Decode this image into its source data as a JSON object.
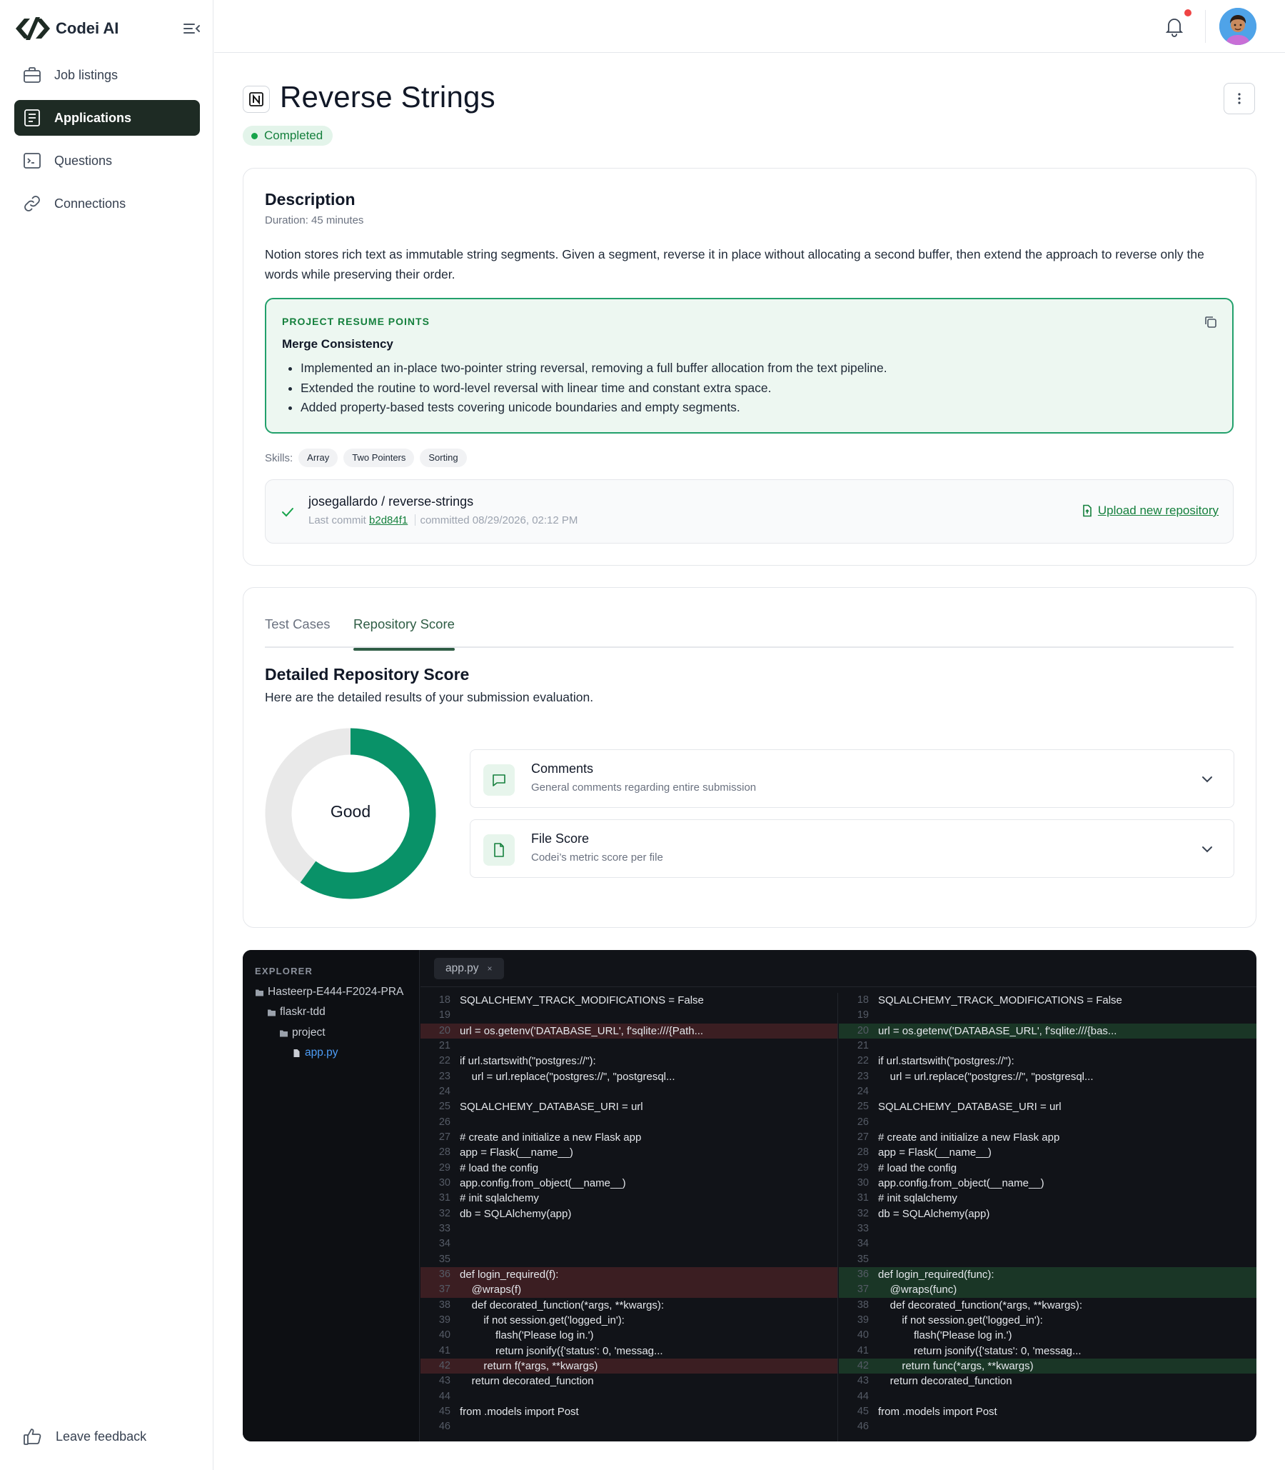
{
  "app": {
    "name": "Codei AI",
    "nav": [
      {
        "label": "Job listings",
        "icon": "briefcase-icon",
        "active": false
      },
      {
        "label": "Applications",
        "icon": "document-icon",
        "active": true
      },
      {
        "label": "Questions",
        "icon": "terminal-icon",
        "active": false
      },
      {
        "label": "Connections",
        "icon": "link-icon",
        "active": false
      }
    ],
    "feedback_label": "Leave feedback",
    "accent": "#1e2b24"
  },
  "header": {
    "title": "Reverse Strings",
    "status": "Completed",
    "status_color": "#15803d"
  },
  "description": {
    "title": "Description",
    "duration": "Duration: 45 minutes",
    "text": "Notion stores rich text as immutable string segments. Given a segment, reverse it in place without allocating a second buffer, then extend the approach to reverse only the words while preserving their order."
  },
  "resume": {
    "label": "PROJECT RESUME POINTS",
    "subtitle": "Merge Consistency",
    "points": [
      "Implemented an in-place two-pointer string reversal, removing a full buffer allocation from the text pipeline.",
      "Extended the routine to word-level reversal with linear time and constant extra space.",
      "Added property-based tests covering unicode boundaries and empty segments."
    ]
  },
  "skills": {
    "label": "Skills:",
    "items": [
      "Array",
      "Two Pointers",
      "Sorting"
    ]
  },
  "repo": {
    "name": "josegallardo / reverse-strings",
    "last_commit_label": "Last commit",
    "sha": "b2d84f1",
    "committed": "committed 08/29/2026, 02:12 PM",
    "upload_label": "Upload new repository"
  },
  "tabs": {
    "items": [
      "Test Cases",
      "Repository Score"
    ],
    "active": "Repository Score"
  },
  "score": {
    "title": "Detailed Repository Score",
    "subtitle": "Here are the detailed results of your submission evaluation.",
    "rating": "Good",
    "fill_fraction": 0.6,
    "fill_color": "#099268",
    "track_color": "#e9e9e9",
    "accordions": [
      {
        "title": "Comments",
        "subtitle": "General comments regarding entire submission",
        "icon": "message-icon"
      },
      {
        "title": "File Score",
        "subtitle": "Codei’s metric score per file",
        "icon": "file-icon"
      }
    ]
  },
  "code": {
    "explorer_label": "EXPLORER",
    "tree": [
      {
        "name": "Hasteerp-E444-F2024-PRA",
        "type": "folder",
        "depth": 0
      },
      {
        "name": "flaskr-tdd",
        "type": "folder",
        "depth": 1
      },
      {
        "name": "project",
        "type": "folder",
        "depth": 2
      },
      {
        "name": "app.py",
        "type": "file",
        "depth": 3,
        "active": true
      }
    ],
    "tab": "app.py",
    "tab_close": "×",
    "left": [
      {
        "n": 18,
        "t": "SQLALCHEMY_TRACK_MODIFICATIONS = False",
        "k": ""
      },
      {
        "n": 19,
        "t": "",
        "k": ""
      },
      {
        "n": 20,
        "t": "url = os.getenv('DATABASE_URL', f'sqlite:///{Path...",
        "k": "del"
      },
      {
        "n": 21,
        "t": "",
        "k": ""
      },
      {
        "n": 22,
        "t": "if url.startswith(\"postgres://\"):",
        "k": ""
      },
      {
        "n": 23,
        "t": "    url = url.replace(\"postgres://\", \"postgresql...",
        "k": ""
      },
      {
        "n": 24,
        "t": "",
        "k": ""
      },
      {
        "n": 25,
        "t": "SQLALCHEMY_DATABASE_URI = url",
        "k": ""
      },
      {
        "n": 26,
        "t": "",
        "k": ""
      },
      {
        "n": 27,
        "t": "# create and initialize a new Flask app",
        "k": ""
      },
      {
        "n": 28,
        "t": "app = Flask(__name__)",
        "k": ""
      },
      {
        "n": 29,
        "t": "# load the config",
        "k": ""
      },
      {
        "n": 30,
        "t": "app.config.from_object(__name__)",
        "k": ""
      },
      {
        "n": 31,
        "t": "# init sqlalchemy",
        "k": ""
      },
      {
        "n": 32,
        "t": "db = SQLAlchemy(app)",
        "k": ""
      },
      {
        "n": 33,
        "t": "",
        "k": ""
      },
      {
        "n": 34,
        "t": "",
        "k": ""
      },
      {
        "n": 35,
        "t": "",
        "k": ""
      },
      {
        "n": 36,
        "t": "def login_required(f):",
        "k": "del"
      },
      {
        "n": 37,
        "t": "    @wraps(f)",
        "k": "del"
      },
      {
        "n": 38,
        "t": "    def decorated_function(*args, **kwargs):",
        "k": ""
      },
      {
        "n": 39,
        "t": "        if not session.get('logged_in'):",
        "k": ""
      },
      {
        "n": 40,
        "t": "            flash('Please log in.')",
        "k": ""
      },
      {
        "n": 41,
        "t": "            return jsonify({'status': 0, 'messag...",
        "k": ""
      },
      {
        "n": 42,
        "t": "        return f(*args, **kwargs)",
        "k": "del"
      },
      {
        "n": 43,
        "t": "    return decorated_function",
        "k": ""
      },
      {
        "n": 44,
        "t": "",
        "k": ""
      },
      {
        "n": 45,
        "t": "from .models import Post",
        "k": ""
      },
      {
        "n": 46,
        "t": "",
        "k": ""
      }
    ],
    "right": [
      {
        "n": 18,
        "t": "SQLALCHEMY_TRACK_MODIFICATIONS = False",
        "k": ""
      },
      {
        "n": 19,
        "t": "",
        "k": ""
      },
      {
        "n": 20,
        "t": "url = os.getenv('DATABASE_URL', f'sqlite:///{bas...",
        "k": "add"
      },
      {
        "n": 21,
        "t": "",
        "k": ""
      },
      {
        "n": 22,
        "t": "if url.startswith(\"postgres://\"):",
        "k": ""
      },
      {
        "n": 23,
        "t": "    url = url.replace(\"postgres://\", \"postgresql...",
        "k": ""
      },
      {
        "n": 24,
        "t": "",
        "k": ""
      },
      {
        "n": 25,
        "t": "SQLALCHEMY_DATABASE_URI = url",
        "k": ""
      },
      {
        "n": 26,
        "t": "",
        "k": ""
      },
      {
        "n": 27,
        "t": "# create and initialize a new Flask app",
        "k": ""
      },
      {
        "n": 28,
        "t": "app = Flask(__name__)",
        "k": ""
      },
      {
        "n": 29,
        "t": "# load the config",
        "k": ""
      },
      {
        "n": 30,
        "t": "app.config.from_object(__name__)",
        "k": ""
      },
      {
        "n": 31,
        "t": "# init sqlalchemy",
        "k": ""
      },
      {
        "n": 32,
        "t": "db = SQLAlchemy(app)",
        "k": ""
      },
      {
        "n": 33,
        "t": "",
        "k": ""
      },
      {
        "n": 34,
        "t": "",
        "k": ""
      },
      {
        "n": 35,
        "t": "",
        "k": ""
      },
      {
        "n": 36,
        "t": "def login_required(func):",
        "k": "add"
      },
      {
        "n": 37,
        "t": "    @wraps(func)",
        "k": "add"
      },
      {
        "n": 38,
        "t": "    def decorated_function(*args, **kwargs):",
        "k": ""
      },
      {
        "n": 39,
        "t": "        if not session.get('logged_in'):",
        "k": ""
      },
      {
        "n": 40,
        "t": "            flash('Please log in.')",
        "k": ""
      },
      {
        "n": 41,
        "t": "            return jsonify({'status': 0, 'messag...",
        "k": ""
      },
      {
        "n": 42,
        "t": "        return func(*args, **kwargs)",
        "k": "add"
      },
      {
        "n": 43,
        "t": "    return decorated_function",
        "k": ""
      },
      {
        "n": 44,
        "t": "",
        "k": ""
      },
      {
        "n": 45,
        "t": "from .models import Post",
        "k": ""
      },
      {
        "n": 46,
        "t": "",
        "k": ""
      }
    ]
  }
}
